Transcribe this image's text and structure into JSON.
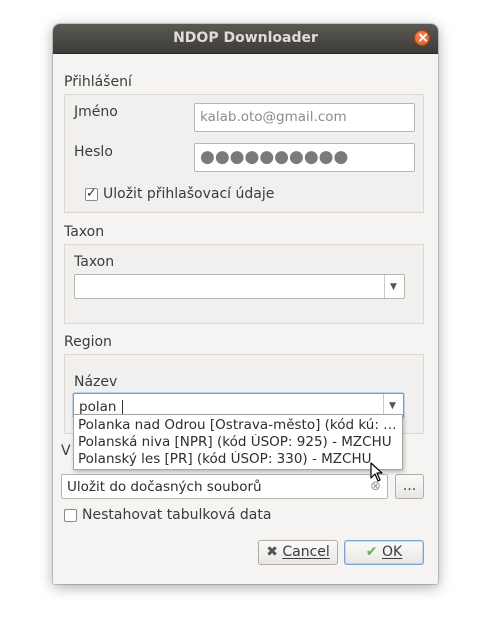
{
  "window": {
    "title": "NDOP Downloader"
  },
  "login": {
    "section_title": "Přihlášení",
    "name_label": "Jméno",
    "name_value": "kalab.oto@gmail.com",
    "password_label": "Heslo",
    "password_mask": "●●●●●●●●●●",
    "save_credentials_label": "Uložit přihlašovací údaje",
    "save_credentials_checked": true
  },
  "taxon": {
    "section_title": "Taxon",
    "field_label": "Taxon",
    "value": ""
  },
  "region": {
    "section_title": "Region",
    "field_label": "Název",
    "value": "polan",
    "suggestions": [
      "Polanka nad Odrou [Ostrava-město] (kód kú: …",
      "Polanská niva [NPR] (kód ÚSOP: 925) - MZCHU",
      "Polanský les [PR] (kód ÚSOP: 330) - MZCHU"
    ]
  },
  "output": {
    "section_title_partial": "V",
    "path_value": "Uložit do dočasných souborů",
    "browse_label": "...",
    "no_table_label": "Nestahovat tabulková data",
    "no_table_checked": false
  },
  "buttons": {
    "cancel_label": "Cancel",
    "ok_label": "OK"
  },
  "colors": {
    "titlebar": "#3d3c38",
    "close": "#e05420",
    "ok_icon": "#6ab04c",
    "cancel_icon": "#555555"
  }
}
